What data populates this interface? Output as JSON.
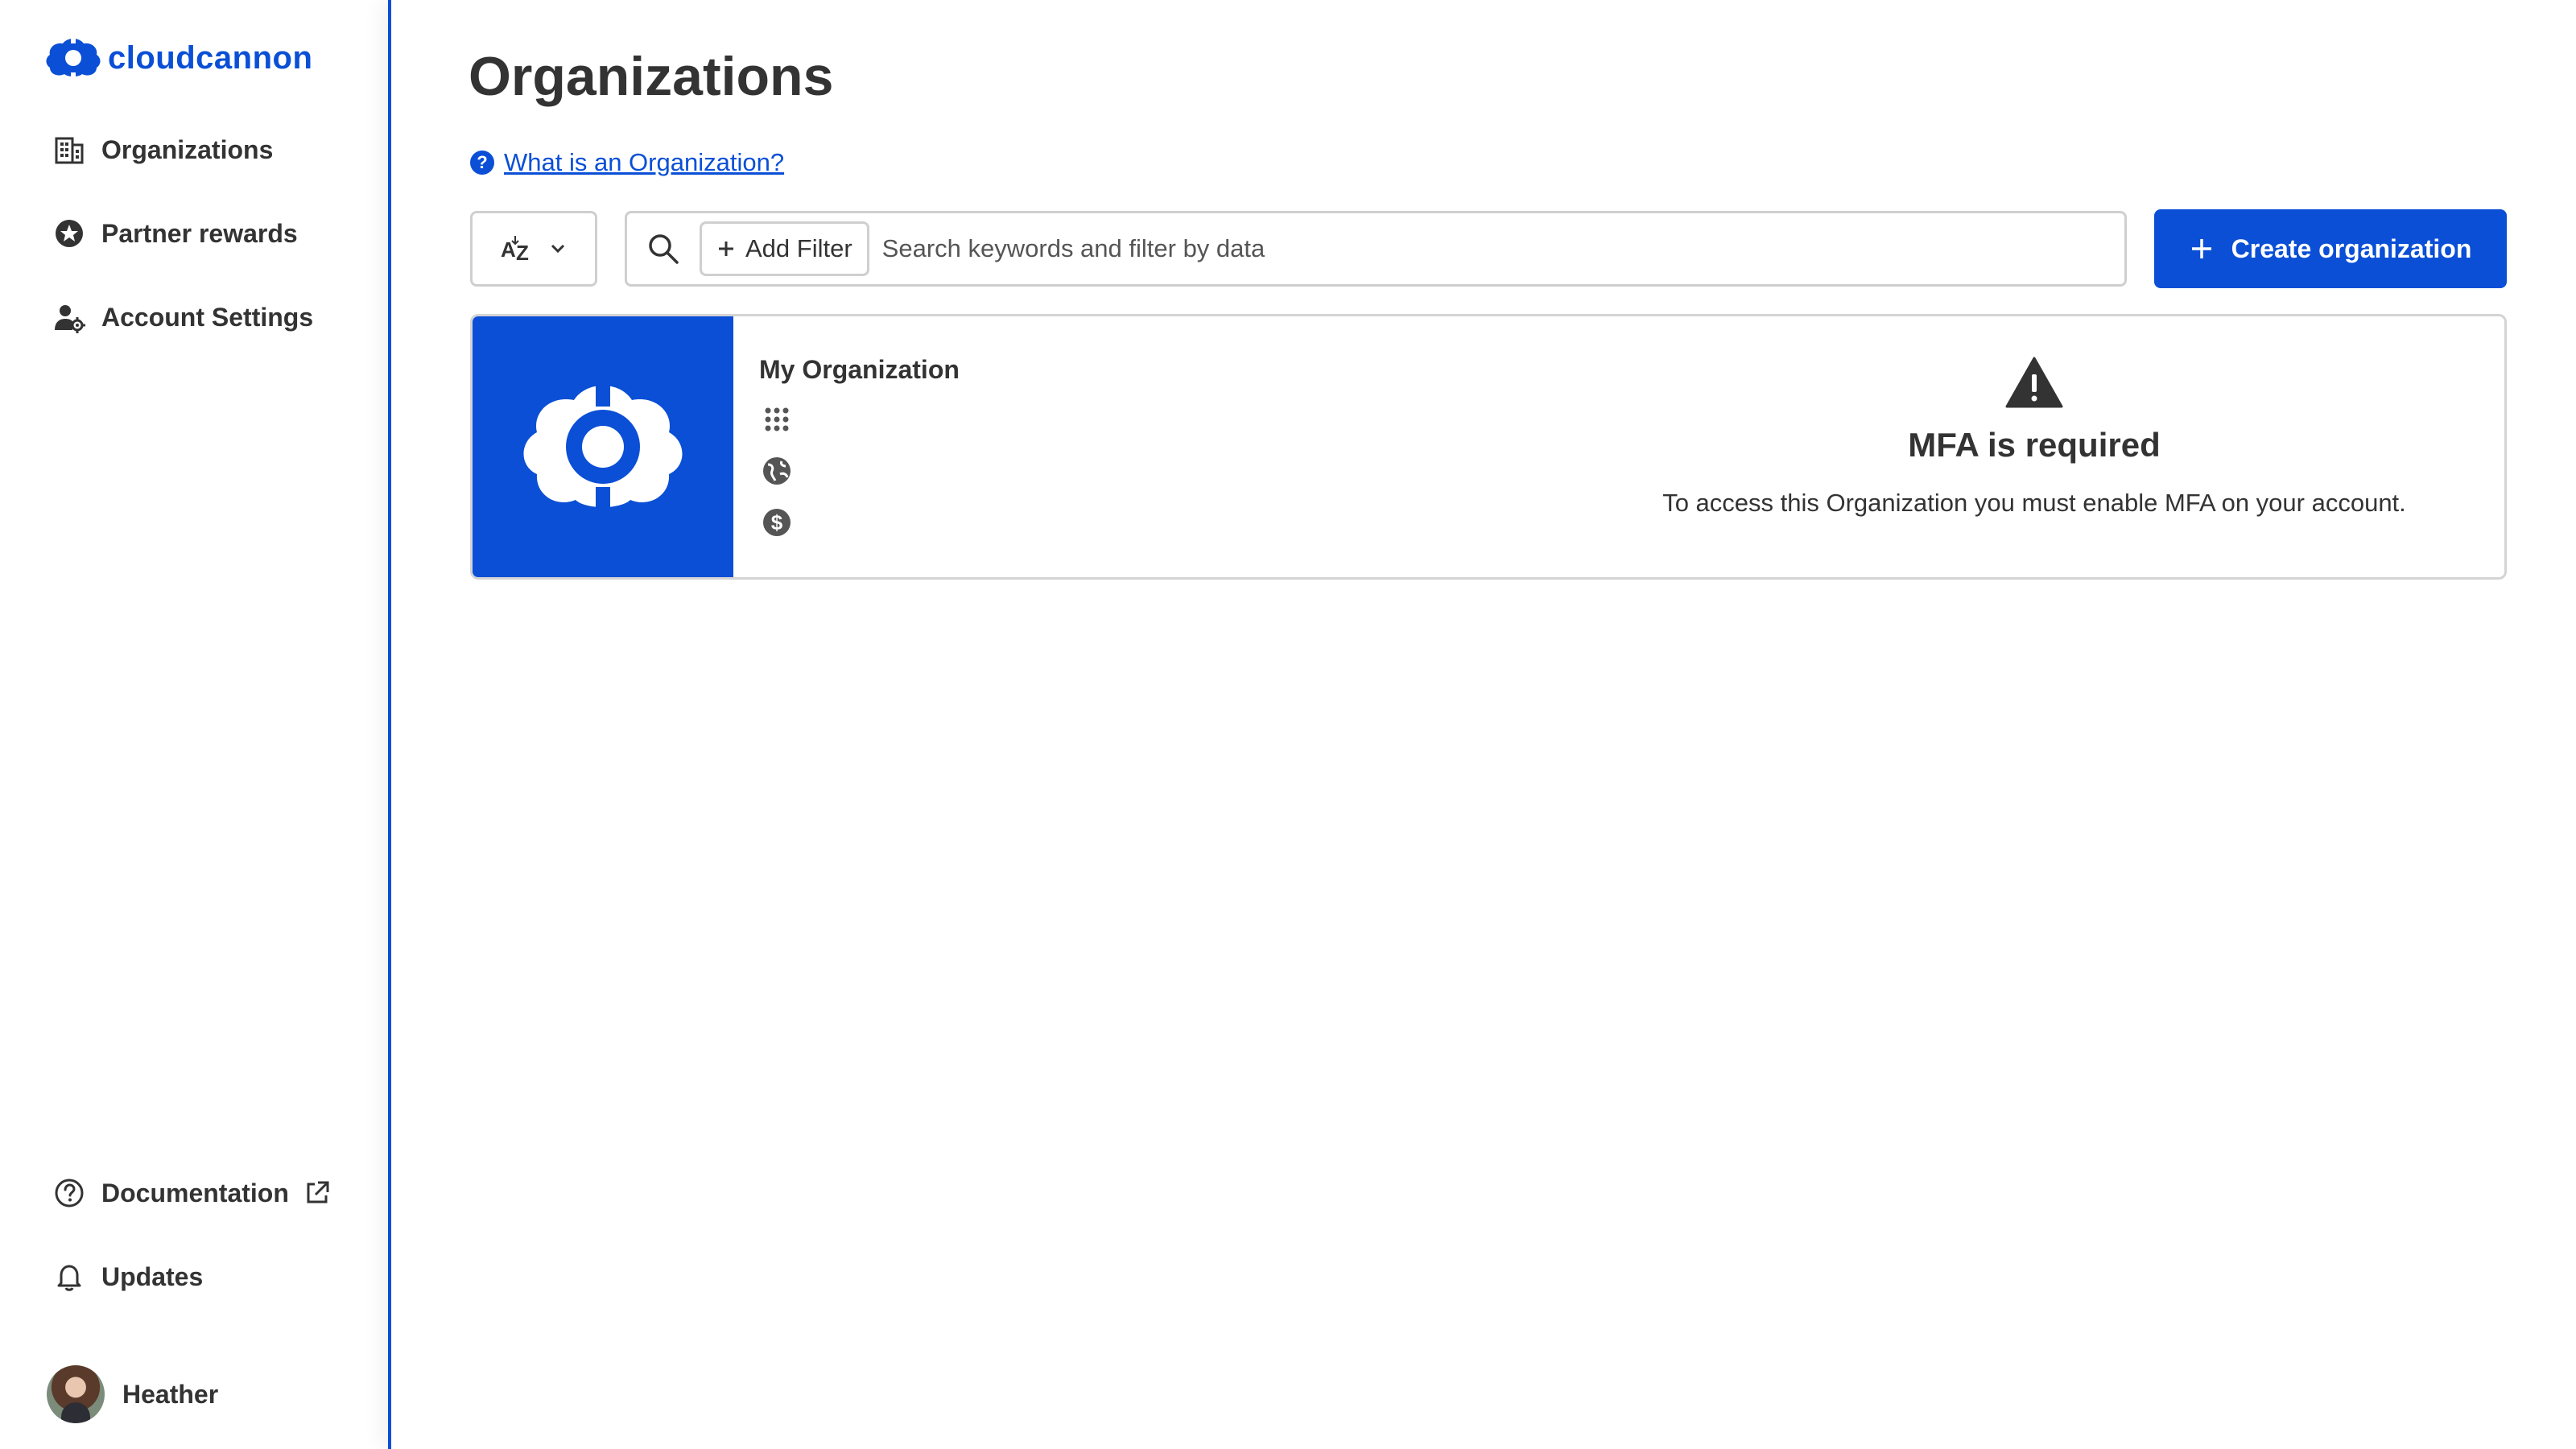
{
  "brand": {
    "name": "cloudcannon",
    "color": "#0a4fd6"
  },
  "sidebar": {
    "items": [
      {
        "label": "Organizations",
        "icon": "building-icon"
      },
      {
        "label": "Partner rewards",
        "icon": "star-badge-icon"
      },
      {
        "label": "Account Settings",
        "icon": "user-gear-icon"
      }
    ],
    "bottom": [
      {
        "label": "Documentation",
        "icon": "question-circle-icon",
        "external_icon": "external-link-icon"
      },
      {
        "label": "Updates",
        "icon": "bell-icon"
      }
    ],
    "user": {
      "name": "Heather"
    }
  },
  "page": {
    "title": "Organizations",
    "help_link": "What is an Organization?"
  },
  "toolbar": {
    "sort_label": "AZ",
    "add_filter_label": "Add Filter",
    "search_placeholder": "Search keywords and filter by data",
    "search_value": "",
    "create_label": "Create organization"
  },
  "organizations": [
    {
      "name": "My Organization",
      "stat_icons": [
        "apps-grid-icon",
        "globe-icon",
        "dollar-icon"
      ],
      "notice": {
        "icon": "warning-icon",
        "title": "MFA is required",
        "text": "To access this Organization you must enable MFA on your account."
      }
    }
  ]
}
